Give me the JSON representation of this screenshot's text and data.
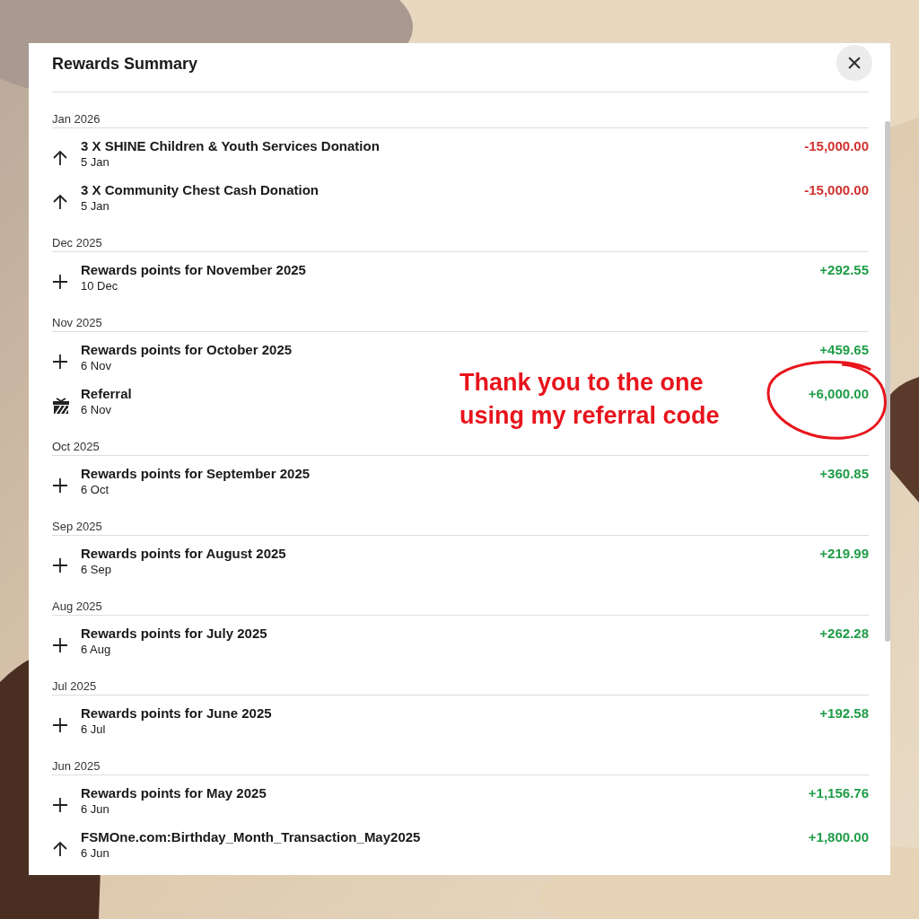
{
  "modal": {
    "title": "Rewards Summary",
    "close": "×"
  },
  "groups": [
    {
      "label": "Jan 2026",
      "items": [
        {
          "kind": "arrow",
          "title": "3 X SHINE Children & Youth Services Donation",
          "date": "5 Jan",
          "amount": "-15,000.00",
          "color": "#d0312d"
        },
        {
          "kind": "arrow",
          "title": "3 X Community Chest Cash Donation",
          "date": "5 Jan",
          "amount": "-15,000.00",
          "color": "#d0312d"
        }
      ]
    },
    {
      "label": "Dec 2025",
      "items": [
        {
          "kind": "plus",
          "title": "Rewards points for November 2025",
          "date": "10 Dec",
          "amount": "+292.55",
          "color": "#1f9d47"
        }
      ]
    },
    {
      "label": "Nov 2025",
      "items": [
        {
          "kind": "plus",
          "title": "Rewards points for October 2025",
          "date": "6 Nov",
          "amount": "+459.65",
          "color": "#1f9d47"
        },
        {
          "kind": "gift",
          "title": "Referral",
          "date": "6 Nov",
          "amount": "+6,000.00",
          "color": "#1f9d47"
        }
      ]
    },
    {
      "label": "Oct 2025",
      "items": [
        {
          "kind": "plus",
          "title": "Rewards points for September 2025",
          "date": "6 Oct",
          "amount": "+360.85",
          "color": "#1f9d47"
        }
      ]
    },
    {
      "label": "Sep 2025",
      "items": [
        {
          "kind": "plus",
          "title": "Rewards points for August 2025",
          "date": "6 Sep",
          "amount": "+219.99",
          "color": "#1f9d47"
        }
      ]
    },
    {
      "label": "Aug 2025",
      "items": [
        {
          "kind": "plus",
          "title": "Rewards points for July 2025",
          "date": "6 Aug",
          "amount": "+262.28",
          "color": "#1f9d47"
        }
      ]
    },
    {
      "label": "Jul 2025",
      "items": [
        {
          "kind": "plus",
          "title": "Rewards points for June 2025",
          "date": "6 Jul",
          "amount": "+192.58",
          "color": "#1f9d47"
        }
      ]
    },
    {
      "label": "Jun 2025",
      "items": [
        {
          "kind": "plus",
          "title": "Rewards points for May 2025",
          "date": "6 Jun",
          "amount": "+1,156.76",
          "color": "#1f9d47"
        },
        {
          "kind": "arrow",
          "title": "FSMOne.com:Birthday_Month_Transaction_May2025",
          "date": "6 Jun",
          "amount": "+1,800.00",
          "color": "#1f9d47"
        }
      ]
    }
  ],
  "annotation": {
    "text": "Thank you to the one using my referral code"
  }
}
